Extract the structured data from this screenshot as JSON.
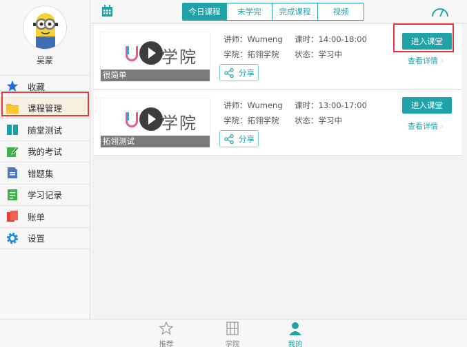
{
  "sidebar": {
    "username": "吴蒙",
    "items": [
      {
        "label": "收藏",
        "icon": "star-icon"
      },
      {
        "label": "课程管理",
        "icon": "folder-icon"
      },
      {
        "label": "随堂测试",
        "icon": "book-icon"
      },
      {
        "label": "我的考试",
        "icon": "edit-icon"
      },
      {
        "label": "错题集",
        "icon": "document-icon"
      },
      {
        "label": "学习记录",
        "icon": "record-icon"
      },
      {
        "label": "账单",
        "icon": "bill-icon"
      },
      {
        "label": "设置",
        "icon": "gear-icon"
      }
    ]
  },
  "header": {
    "tabs": [
      "今日课程",
      "未学完",
      "完成课程",
      "视频"
    ],
    "active_tab": 0
  },
  "courses": [
    {
      "thumb_title": "很简单",
      "logo_text": "学院",
      "teacher": "讲师：Wumeng",
      "time": "课时：14:00-18:00",
      "school": "学院：拓翎学院",
      "status": "状态：学习中",
      "share_label": "分享",
      "enter_label": "进入课堂",
      "detail_label": "查看详情"
    },
    {
      "thumb_title": "拓翎测试",
      "logo_text": "学院",
      "teacher": "讲师：Wumeng",
      "time": "课时：13:00-17:00",
      "school": "学院：拓翎学院",
      "status": "状态：学习中",
      "share_label": "分享",
      "enter_label": "进入课堂",
      "detail_label": "查看详情"
    }
  ],
  "bottom_nav": [
    {
      "label": "推荐",
      "icon": "recommend-icon"
    },
    {
      "label": "学院",
      "icon": "school-icon"
    },
    {
      "label": "我的",
      "icon": "user-icon"
    }
  ],
  "colors": {
    "accent": "#1fa3a8",
    "highlight": "#e23a3a"
  }
}
